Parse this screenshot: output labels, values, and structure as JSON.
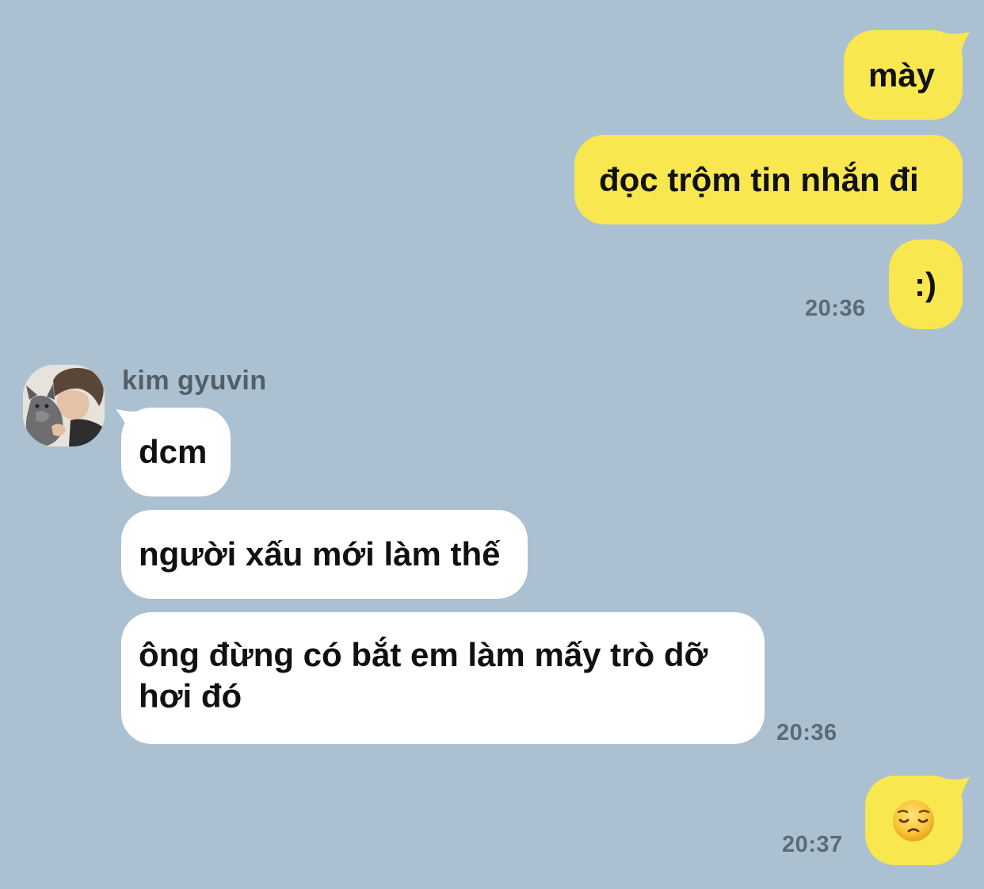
{
  "conversation": {
    "outgoing_1": {
      "messages": [
        "mày",
        "đọc trộm tin nhắn đi",
        ":)"
      ],
      "time": "20:36"
    },
    "incoming": {
      "sender_name": "kim gyuvin",
      "avatar": "profile-photo-person-with-dog",
      "messages": [
        "dcm",
        "người xấu mới làm thế",
        "ông đừng có bắt em làm mấy trò dỡ hơi đó"
      ],
      "time": "20:36"
    },
    "outgoing_2": {
      "messages": [],
      "emoji": "pensive-face-emoji",
      "time": "20:37"
    }
  },
  "colors": {
    "background": "#abc1d1",
    "outgoing_bubble": "#f9e74f",
    "incoming_bubble": "#ffffff",
    "timestamp": "#5e6a73",
    "sender_name": "#545e66"
  }
}
